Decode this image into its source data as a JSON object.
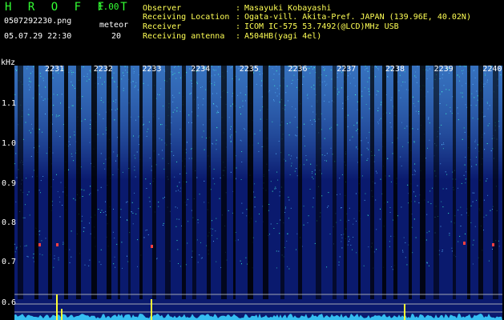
{
  "header": {
    "app_title": "H R O F F T",
    "version": "1.00",
    "file_name": "0507292230.png",
    "datetime": "05.07.29 22:30",
    "meteor_label": "meteor",
    "meteor_count": "20"
  },
  "station_info": [
    {
      "key": "Observer",
      "sep": ":",
      "value": "Masayuki Kobayashi"
    },
    {
      "key": "Receiving Location",
      "sep": ":",
      "value": "Ogata-vill. Akita-Pref. JAPAN (139.96E, 40.02N)"
    },
    {
      "key": "Receiver",
      "sep": ":",
      "value": "ICOM IC-575 53.7492(@LCD)MHz USB"
    },
    {
      "key": "Receiving antenna",
      "sep": ":",
      "value": "A504HB(yagi 4el)"
    }
  ],
  "spectrogram": {
    "y_unit": "kHz",
    "y_ticks": [
      "1.1",
      "1.0",
      "0.9",
      "0.8",
      "0.7",
      "0.6"
    ],
    "x_ticks": [
      "2231",
      "2232",
      "2233",
      "2234",
      "2235",
      "2236",
      "2237",
      "2238",
      "2239",
      "2240"
    ],
    "colors": {
      "background": "#0a1a6e",
      "bright": "#5ab8ff",
      "speck": "#40ffd0",
      "trace": "#ffff33",
      "echo": "#ff4040",
      "gap": "#000000"
    }
  }
}
